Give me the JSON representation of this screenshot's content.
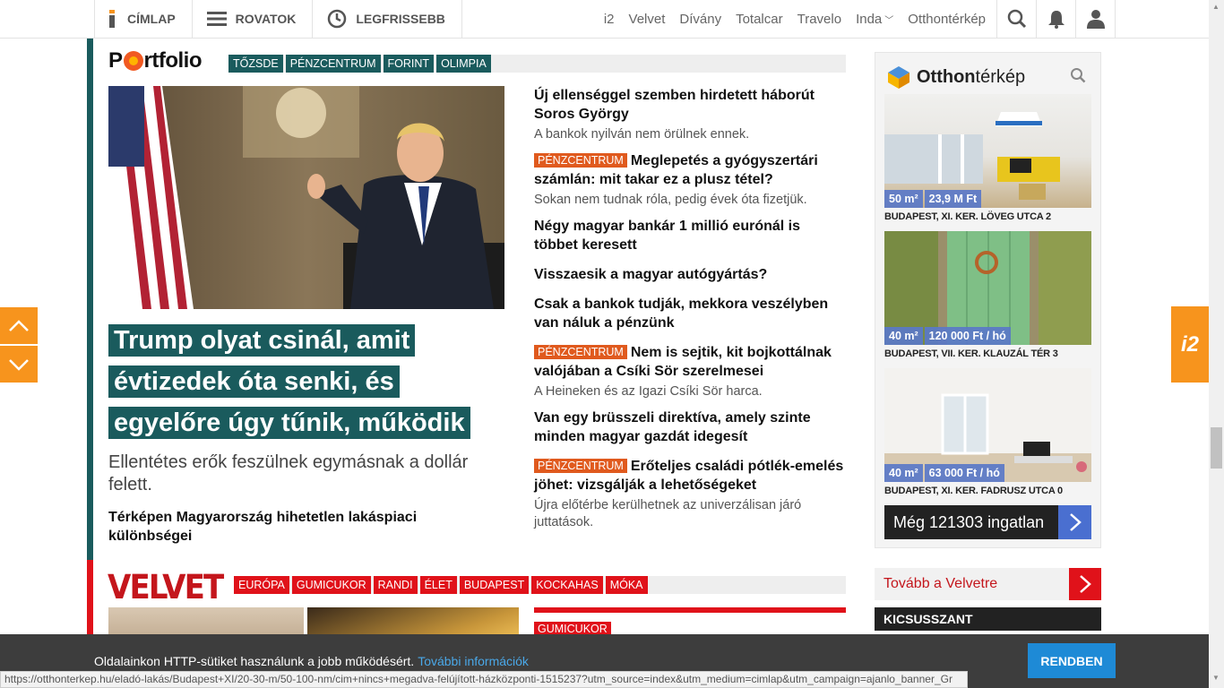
{
  "nav": {
    "home": "CÍMLAP",
    "sections": "ROVATOK",
    "latest": "LEGFRISSEBB",
    "links": [
      "i2",
      "Velvet",
      "Dívány",
      "Totalcar",
      "Travelo",
      "Inda",
      "Otthontérkép"
    ]
  },
  "portfolio": {
    "logo": "Portfolio",
    "tags": [
      "TŐZSDE",
      "PÉNZCENTRUM",
      "FORINT",
      "OLIMPIA"
    ],
    "hero": {
      "title": "Trump olyat csinál, amit évtizedek óta senki, és egyelőre úgy tűnik, működik",
      "lead": "Ellentétes erők feszülnek egymásnak a dollár felett.",
      "sub": "Térképen Magyarország hihetetlen lakáspiaci különbségei"
    },
    "articles": [
      {
        "kicker": "",
        "title": "Új ellenséggel szemben hirdetett háborút Soros György",
        "lead": "A bankok nyilván nem örülnek ennek."
      },
      {
        "kicker": "PÉNZCENTRUM",
        "title": "Meglepetés a gyógyszertári számlán: mit takar ez a plusz tétel?",
        "lead": "Sokan nem tudnak róla, pedig évek óta fizetjük."
      },
      {
        "kicker": "",
        "title": "Négy magyar bankár 1 millió eurónál is többet keresett",
        "lead": ""
      },
      {
        "kicker": "",
        "title": "Visszaesik a magyar autógyártás?",
        "lead": ""
      },
      {
        "kicker": "",
        "title": "Csak a bankok tudják, mekkora veszélyben van náluk a pénzünk",
        "lead": ""
      },
      {
        "kicker": "PÉNZCENTRUM",
        "title": "Nem is sejtik, kit bojkottálnak valójában a Csíki Sör szerelmesei",
        "lead": "A Heineken és az Igazi Csíki Sör harca."
      },
      {
        "kicker": "",
        "title": "Van egy brüsszeli direktíva, amely szinte minden magyar gazdát idegesít",
        "lead": ""
      },
      {
        "kicker": "PÉNZCENTRUM",
        "title": "Erőteljes családi pótlék-emelés jöhet: vizsgálják a lehetőségeket",
        "lead": "Újra előtérbe kerülhetnek az univerzálisan járó juttatások."
      }
    ]
  },
  "velvet": {
    "logo": "VELVET",
    "tags": [
      "EURÓPA",
      "GUMICUKOR",
      "RANDI",
      "ÉLET",
      "BUDAPEST",
      "KOCKAHAS",
      "MÓKA"
    ],
    "kicker": "GUMICUKOR"
  },
  "otthonterkep": {
    "logo_a": "Otthon",
    "logo_b": "térkép",
    "listings": [
      {
        "area": "50 m²",
        "price": "23,9 M Ft",
        "address": "BUDAPEST, XI. KER. LÖVEG UTCA 2"
      },
      {
        "area": "40 m²",
        "price": "120 000 Ft / hó",
        "address": "BUDAPEST, VII. KER. KLAUZÁL TÉR 3"
      },
      {
        "area": "40 m²",
        "price": "63 000 Ft / hó",
        "address": "BUDAPEST, XI. KER. FADRUSZ UTCA 0"
      }
    ],
    "more": "Még 121303 ingatlan"
  },
  "right": {
    "velvet_link": "Tovább a Velvetre",
    "kicsusszant": "KICSUSSZANT"
  },
  "side": {
    "i2": "i2"
  },
  "cookie": {
    "message": "Oldalainkon HTTP-sütiket használunk a jobb működésért.",
    "link": "További információk",
    "button": "RENDBEN"
  },
  "status_url": "https://otthonterkep.hu/eladó-lakás/Budapest+XI/20-30-m/50-100-nm/cim+nincs+megadva-felújított-házközponti-1515237?utm_source=index&utm_medium=cimlap&utm_campaign=ajanlo_banner_Gr",
  "colors": {
    "portfolio": "#1a5b5d",
    "velvet": "#e0121a",
    "kicker": "#e05a1e",
    "accent": "#f7941d",
    "cookie_btn": "#1e8ad6"
  }
}
